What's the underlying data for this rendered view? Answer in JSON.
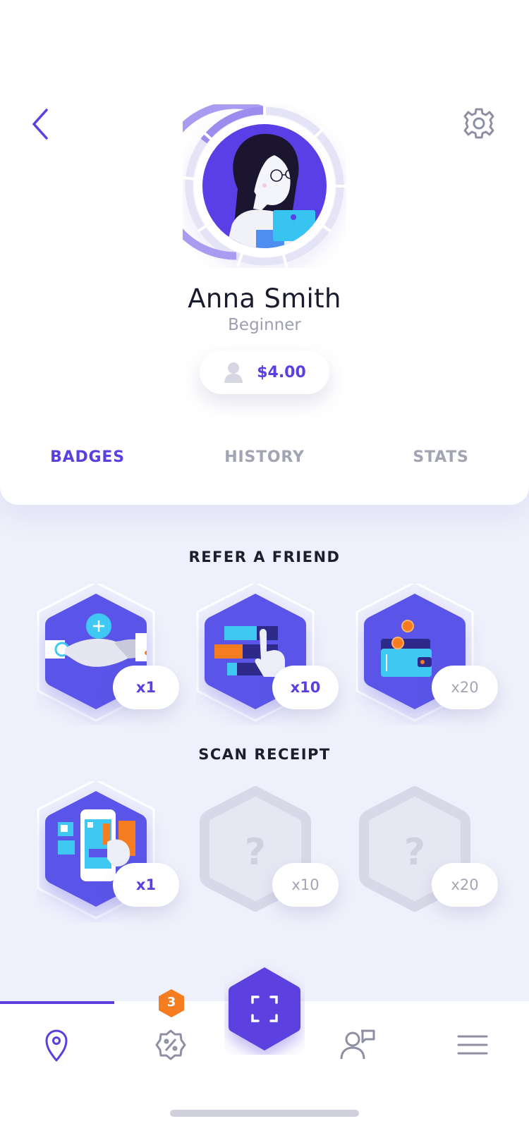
{
  "profile": {
    "name": "Anna Smith",
    "level": "Beginner",
    "balance": "$4.00"
  },
  "tabs": [
    {
      "label": "BADGES",
      "active": true
    },
    {
      "label": "HISTORY",
      "active": false
    },
    {
      "label": "STATS",
      "active": false
    }
  ],
  "sections": {
    "refer": {
      "title": "REFER A FRIEND",
      "badges": [
        {
          "icon": "handshake-icon",
          "count": "x1",
          "unlocked": true
        },
        {
          "icon": "tap-blocks-icon",
          "count": "x10",
          "unlocked": true
        },
        {
          "icon": "wallet-coins-icon",
          "count": "x20",
          "unlocked": true
        }
      ]
    },
    "scan": {
      "title": "SCAN RECEIPT",
      "badges": [
        {
          "icon": "phone-scan-icon",
          "count": "x1",
          "unlocked": true
        },
        {
          "icon": "locked-question-icon",
          "count": "x10",
          "unlocked": false,
          "symbol": "?"
        },
        {
          "icon": "locked-question-icon",
          "count": "x20",
          "unlocked": false,
          "symbol": "?"
        }
      ]
    }
  },
  "nav": {
    "notification_count": "3",
    "items": [
      "map-pin-icon",
      "discount-icon",
      "scan-icon",
      "contacts-icon",
      "menu-icon"
    ]
  },
  "colors": {
    "accent": "#5c3fe0",
    "badge_blue": "#5a55e8",
    "orange": "#f57d1f",
    "cyan": "#3fc8f2",
    "muted": "#a3a4b5"
  }
}
